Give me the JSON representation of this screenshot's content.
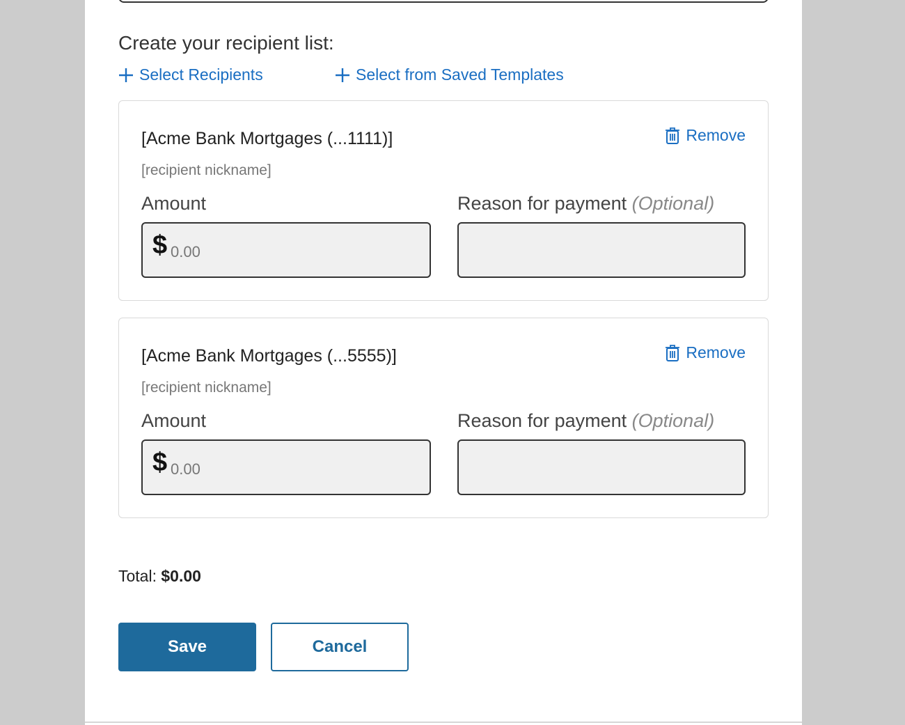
{
  "heading": "Create your recipient list:",
  "links": {
    "select_recipients": "Select Recipients",
    "select_templates": "Select from Saved Templates"
  },
  "recipients": [
    {
      "name": "[Acme Bank Mortgages (...1111)]",
      "nickname": "[recipient nickname]",
      "remove_label": "Remove",
      "amount_label": "Amount",
      "currency_symbol": "$",
      "amount_placeholder": "0.00",
      "reason_label": "Reason for payment",
      "reason_optional": "(Optional)",
      "reason_value": ""
    },
    {
      "name": "[Acme Bank Mortgages (...5555)]",
      "nickname": "[recipient nickname]",
      "remove_label": "Remove",
      "amount_label": "Amount",
      "currency_symbol": "$",
      "amount_placeholder": "0.00",
      "reason_label": "Reason for payment",
      "reason_optional": "(Optional)",
      "reason_value": ""
    }
  ],
  "total": {
    "label": "Total:",
    "value": "$0.00"
  },
  "buttons": {
    "save": "Save",
    "cancel": "Cancel"
  },
  "colors": {
    "link": "#1a6ec2",
    "primary": "#1e6a9c",
    "backdrop": "#cccccc"
  },
  "icons": {
    "add": "plus-icon",
    "remove": "trash-icon"
  }
}
